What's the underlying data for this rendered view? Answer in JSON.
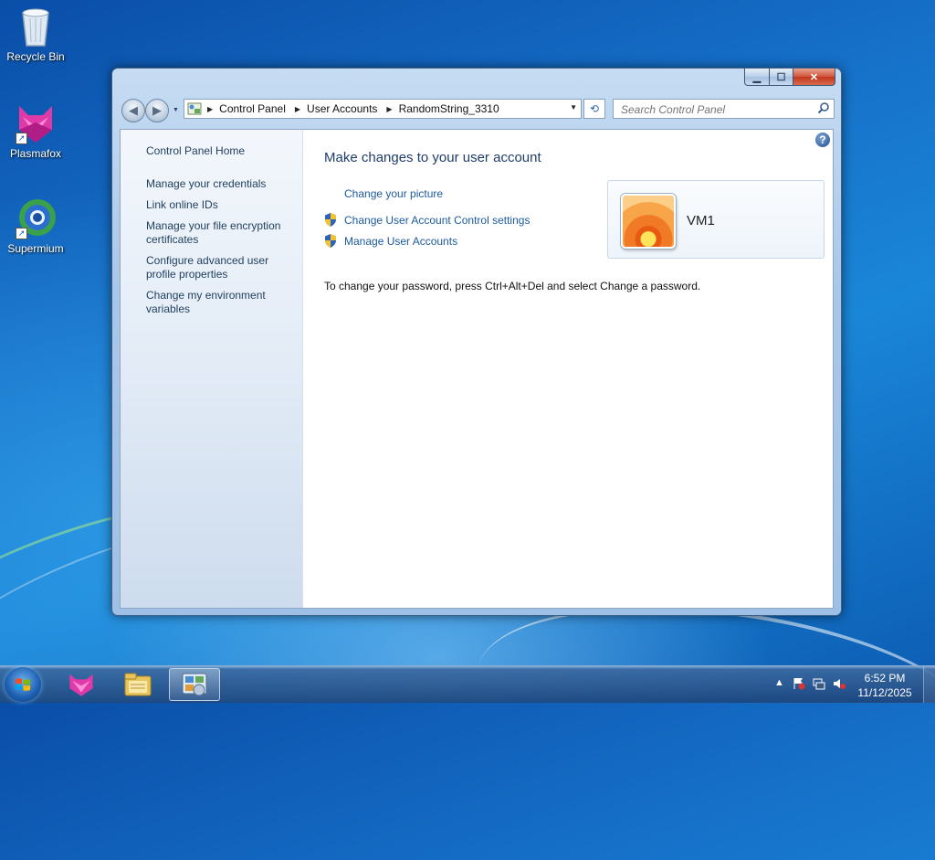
{
  "desktop": {
    "icons": [
      {
        "label": "Recycle Bin",
        "icon": "recycle-bin-icon"
      },
      {
        "label": "Plasmafox",
        "icon": "plasmafox-icon"
      },
      {
        "label": "Supermium",
        "icon": "supermium-icon"
      }
    ]
  },
  "window": {
    "controls": {
      "minimize": "minimize-icon",
      "maximize": "maximize-icon",
      "close": "close-icon"
    },
    "address_bar": {
      "breadcrumbs": [
        "Control Panel",
        "User Accounts",
        "RandomString_3310"
      ]
    },
    "search": {
      "placeholder": "Search Control Panel"
    },
    "left_pane": {
      "home": "Control Panel Home",
      "tasks": [
        "Manage your credentials",
        "Link online IDs",
        "Manage your file encryption certificates",
        "Configure advanced user profile properties",
        "Change my environment variables"
      ]
    },
    "main": {
      "heading": "Make changes to your user account",
      "links": {
        "change_picture": "Change your picture",
        "uac_settings": "Change User Account Control settings",
        "manage_accounts": "Manage User Accounts"
      },
      "user": {
        "name": "VM1"
      },
      "password_note": "To change your password, press Ctrl+Alt+Del and select Change a password."
    }
  },
  "taskbar": {
    "apps": [
      "plasmafox-icon",
      "windows-explorer-icon",
      "control-panel-icon"
    ],
    "active_app": "control-panel-icon",
    "clock": {
      "time": "6:52 PM",
      "date": "11/12/2025"
    }
  }
}
